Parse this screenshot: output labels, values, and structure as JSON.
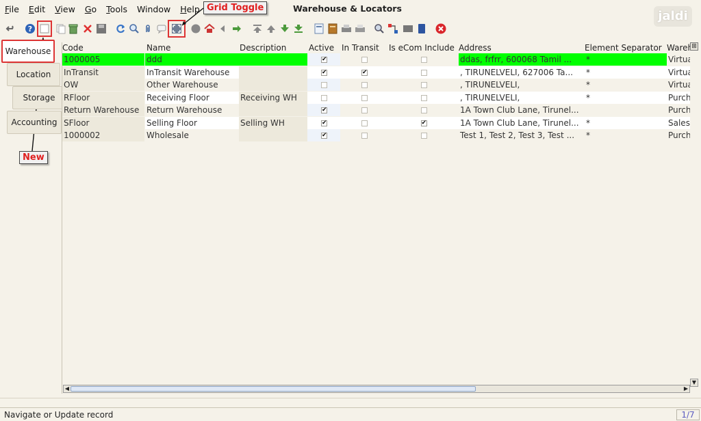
{
  "menu": [
    "File",
    "Edit",
    "View",
    "Go",
    "Tools",
    "Window",
    "Help"
  ],
  "menu_mnemonics": [
    "F",
    "E",
    "V",
    "G",
    "T",
    "",
    "H"
  ],
  "window_title": "Warehouse & Locators",
  "logo_text": "jaldi",
  "annotations": {
    "grid_toggle": "Grid Toggle",
    "new": "New"
  },
  "toolbar_icons": [
    "undo-icon",
    "help-icon",
    "new-record-icon",
    "copy-record-icon",
    "delete-selection-icon",
    "delete-icon",
    "save-icon",
    "refresh-icon",
    "find-icon",
    "attachment-icon",
    "chat-icon",
    "grid-toggle-icon",
    "history-icon",
    "home-icon",
    "previous-icon",
    "next-icon",
    "first-record-icon",
    "previous-record-icon",
    "next-record-icon",
    "last-record-icon",
    "report-icon",
    "archive-icon",
    "print-preview-icon",
    "print-icon",
    "zoom-across-icon",
    "workflow-icon",
    "product-info-icon",
    "request-icon",
    "exit-icon"
  ],
  "side_tabs": [
    "Warehouse",
    "Location",
    "Storage",
    "Accounting"
  ],
  "columns": [
    "Code",
    "Name",
    "Description",
    "Active",
    "In Transit",
    "Is eCom Include",
    "Address",
    "Element Separator",
    "Wareh"
  ],
  "rows": [
    {
      "code": "1000005",
      "name": "ddd",
      "description": "",
      "active": true,
      "in_transit": false,
      "ecom": false,
      "address": "ddas, frfrr,  600068 Tamil ...",
      "separator": "*",
      "type": "Virtua",
      "selected": true
    },
    {
      "code": "InTransit",
      "name": "InTransit Warehouse",
      "description": "",
      "active": true,
      "in_transit": true,
      "ecom": false,
      "address": ", TIRUNELVELI,  627006 Ta...",
      "separator": "*",
      "type": "Virtua"
    },
    {
      "code": "OW",
      "name": "Other Warehouse",
      "description": "",
      "active": false,
      "in_transit": false,
      "ecom": false,
      "address": ", TIRUNELVELI,",
      "separator": "*",
      "type": "Virtua"
    },
    {
      "code": "RFloor",
      "name": "Receiving Floor",
      "description": "Receiving WH",
      "active": false,
      "in_transit": false,
      "ecom": false,
      "address": ", TIRUNELVELI,",
      "separator": "*",
      "type": "Purch"
    },
    {
      "code": "Return Warehouse",
      "name": "Return Warehouse",
      "description": "",
      "active": true,
      "in_transit": false,
      "ecom": false,
      "address": "1A Town Club Lane, Tirunel...",
      "separator": "",
      "type": "Purch"
    },
    {
      "code": "SFloor",
      "name": "Selling Floor",
      "description": "Selling WH",
      "active": true,
      "in_transit": false,
      "ecom": true,
      "address": "1A Town Club Lane, Tirunel...",
      "separator": "*",
      "type": "Sales"
    },
    {
      "code": "1000002",
      "name": "Wholesale",
      "description": "",
      "active": true,
      "in_transit": false,
      "ecom": false,
      "address": "Test 1, Test 2, Test 3, Test ...",
      "separator": "*",
      "type": "Purch"
    }
  ],
  "status_text": "Navigate or Update record",
  "record_count": "1/7",
  "colors": {
    "background": "#f5f2e9",
    "selected_row": "#00ff00",
    "callout": "#dd3333",
    "record_count_text": "#5a5ac0"
  }
}
